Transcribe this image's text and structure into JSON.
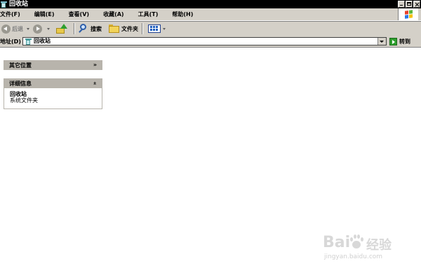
{
  "window": {
    "title": "回收站"
  },
  "menubar": {
    "items": [
      {
        "label": "文件(F)"
      },
      {
        "label": "编辑(E)"
      },
      {
        "label": "查看(V)"
      },
      {
        "label": "收藏(A)"
      },
      {
        "label": "工具(T)"
      },
      {
        "label": "帮助(H)"
      }
    ]
  },
  "toolbar": {
    "back_label": "后退",
    "search_label": "搜索",
    "folders_label": "文件夹"
  },
  "addressbar": {
    "label": "地址(D)",
    "value": "回收站",
    "go_label": "转到"
  },
  "panels": {
    "other_places": {
      "title": "其它位置",
      "expanded": false
    },
    "details": {
      "title": "详细信息",
      "expanded": true,
      "name": "回收站",
      "type": "系统文件夹"
    }
  },
  "watermark": {
    "brand": "Bai",
    "suffix": "经验",
    "url": "jingyan.baidu.com"
  },
  "icons": {
    "title_icon": "recycle-bin-icon",
    "logo": "windows-logo-icon",
    "back": "back-arrow-icon",
    "forward": "forward-arrow-icon",
    "up": "up-folder-icon",
    "search": "search-icon",
    "folders": "folder-icon",
    "views": "views-icon",
    "go": "go-arrow-icon"
  }
}
